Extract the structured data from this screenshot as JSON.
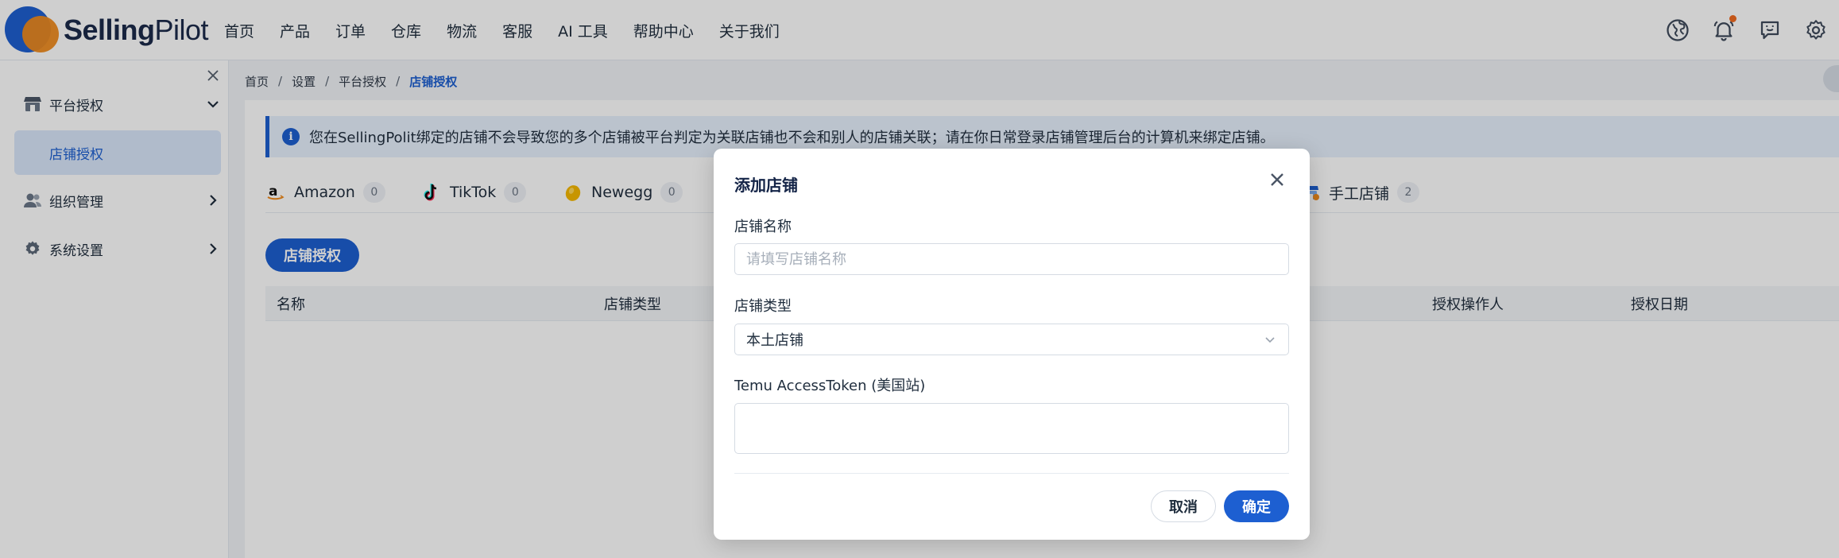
{
  "brand": {
    "name_bold": "Selling",
    "name_light": "Pilot"
  },
  "nav": [
    "首页",
    "产品",
    "订单",
    "仓库",
    "物流",
    "客服",
    "AI 工具",
    "帮助中心",
    "关于我们"
  ],
  "header_icons": [
    "globe-icon",
    "bell-icon",
    "message-icon",
    "settings-icon"
  ],
  "sidebar": {
    "groups": [
      {
        "label": "平台授权",
        "icon": "store-icon",
        "expanded": true
      },
      {
        "label": "组织管理",
        "icon": "users-icon",
        "expanded": false
      },
      {
        "label": "系统设置",
        "icon": "gear-icon",
        "expanded": false
      }
    ],
    "active_sub": "店铺授权"
  },
  "breadcrumb": [
    "首页",
    "设置",
    "平台授权",
    "店铺授权"
  ],
  "notice": "您在SellingPolit绑定的店铺不会导致您的多个店铺被平台判定为关联店铺也不会和别人的店铺关联；请在你日常登录店铺管理后台的计算机来绑定店铺。",
  "platform_tabs": [
    {
      "name": "Amazon",
      "count": "0"
    },
    {
      "name": "TikTok",
      "count": "0"
    },
    {
      "name": "Newegg",
      "count": "0"
    },
    {
      "name": "手工店铺",
      "count": "2"
    }
  ],
  "auth_button": "店铺授权",
  "table_headers": [
    "名称",
    "店铺类型",
    "授权操作人",
    "授权日期"
  ],
  "modal": {
    "title": "添加店铺",
    "field_name_label": "店铺名称",
    "field_name_placeholder": "请填写店铺名称",
    "field_type_label": "店铺类型",
    "field_type_value": "本土店铺",
    "field_token_label": "Temu AccessToken (美国站)",
    "cancel": "取消",
    "confirm": "确定"
  },
  "colors": {
    "primary": "#1d5fd1",
    "accent": "#f08a1c",
    "notice_bg": "#e7f0fd"
  }
}
